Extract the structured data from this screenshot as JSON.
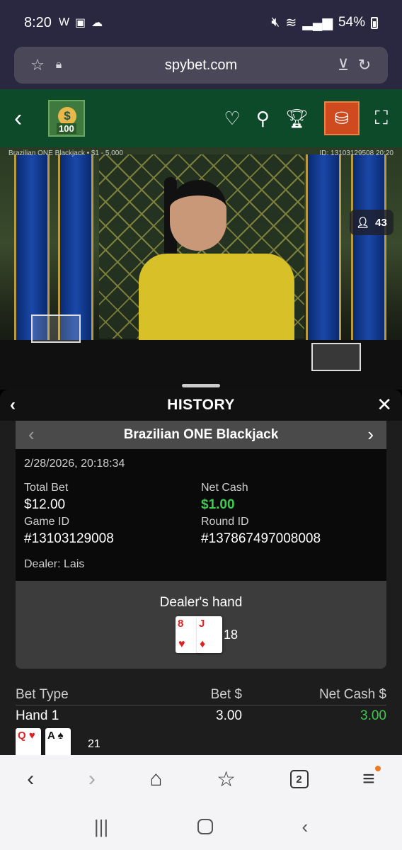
{
  "status": {
    "time": "8:20",
    "battery": "54%"
  },
  "browser": {
    "url": "spybet.com",
    "tab_count": "2"
  },
  "casino_nav": {
    "logo_amount": "100"
  },
  "video": {
    "table_info": "Brazilian ONE Blackjack • $1 - 5,000",
    "table_id": "ID: 13103129508 20:20",
    "viewers": "43"
  },
  "history": {
    "title": "HISTORY",
    "game_name": "Brazilian ONE Blackjack",
    "date": "2/28/2026, 20:18:34",
    "total_bet_label": "Total Bet",
    "total_bet": "$12.00",
    "net_cash_label": "Net Cash",
    "net_cash": "$1.00",
    "game_id_label": "Game ID",
    "game_id": "#13103129008",
    "round_id_label": "Round ID",
    "round_id": "#137867497008008",
    "dealer": "Dealer: Lais",
    "dealer_hand_label": "Dealer's hand",
    "dealer_cards": [
      {
        "rank": "8",
        "suit": "♥"
      },
      {
        "rank": "J",
        "suit": "♦"
      }
    ],
    "dealer_score": "18",
    "bets_headers": {
      "type": "Bet Type",
      "bet": "Bet $",
      "net": "Net Cash $"
    },
    "bets": [
      {
        "type": "Hand 1",
        "bet": "3.00",
        "net": "3.00"
      }
    ],
    "player_cards": [
      {
        "rank": "Q",
        "suit": "♥"
      },
      {
        "rank": "A",
        "suit": "♠"
      }
    ],
    "player_score": "21"
  }
}
